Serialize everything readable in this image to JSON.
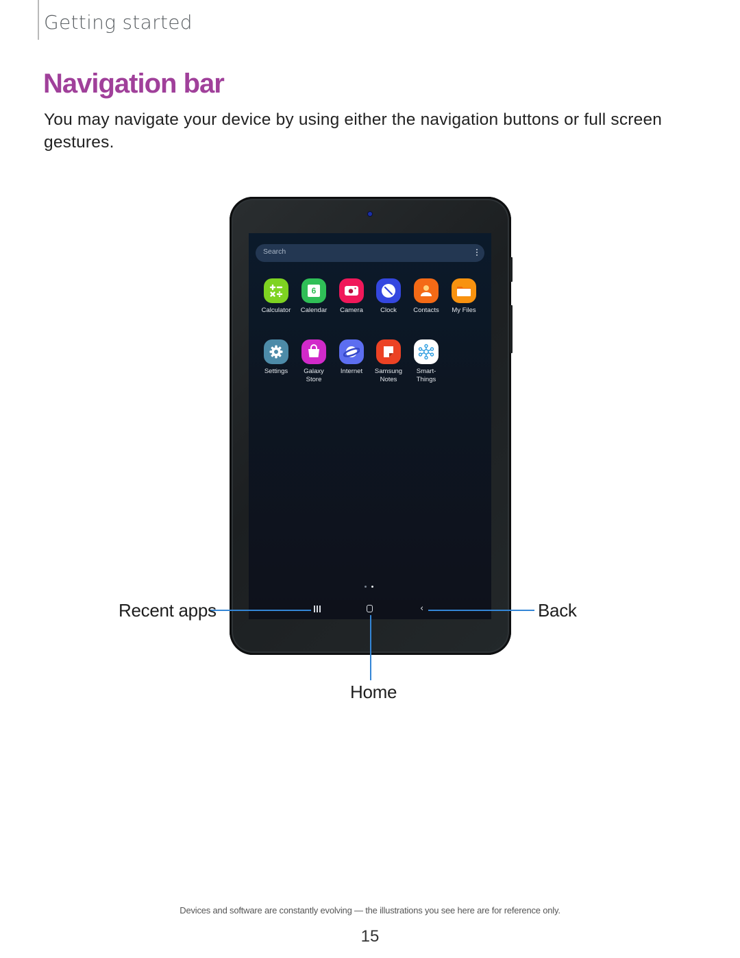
{
  "header": {
    "section": "Getting started"
  },
  "page": {
    "title": "Navigation bar",
    "title_color": "#a0409a",
    "intro": "You may navigate your device by using either the navigation buttons or full screen gestures."
  },
  "device": {
    "search_placeholder": "Search",
    "apps": [
      {
        "label": "Calculator",
        "icon": "calculator-icon",
        "color": "#7ed321"
      },
      {
        "label": "Calendar",
        "icon": "calendar-icon",
        "color": "#2fbf57",
        "badge": "6"
      },
      {
        "label": "Camera",
        "icon": "camera-icon",
        "color": "#f0185a"
      },
      {
        "label": "Clock",
        "icon": "clock-icon",
        "color": "#3447e0"
      },
      {
        "label": "Contacts",
        "icon": "contacts-icon",
        "color": "#f46a16"
      },
      {
        "label": "My Files",
        "icon": "folder-icon",
        "color": "#f8920f"
      },
      {
        "label": "Settings",
        "icon": "gear-icon",
        "color": "#4d8ba8"
      },
      {
        "label": "Galaxy\nStore",
        "icon": "shopping-bag-icon",
        "color": "#d12ac9"
      },
      {
        "label": "Internet",
        "icon": "planet-icon",
        "color": "#5c6ef0"
      },
      {
        "label": "Samsung\nNotes",
        "icon": "notes-icon",
        "color": "#ec4224"
      },
      {
        "label": "Smart-\nThings",
        "icon": "smartthings-icon",
        "color": "#ffffff"
      }
    ],
    "page_indicator": {
      "pages": 2,
      "current": 2
    }
  },
  "callouts": {
    "recent": "Recent apps",
    "home": "Home",
    "back": "Back",
    "line_color": "#3486d6"
  },
  "footer": {
    "note": "Devices and software are constantly evolving — the illustrations you see here are for reference only.",
    "page_number": "15"
  }
}
